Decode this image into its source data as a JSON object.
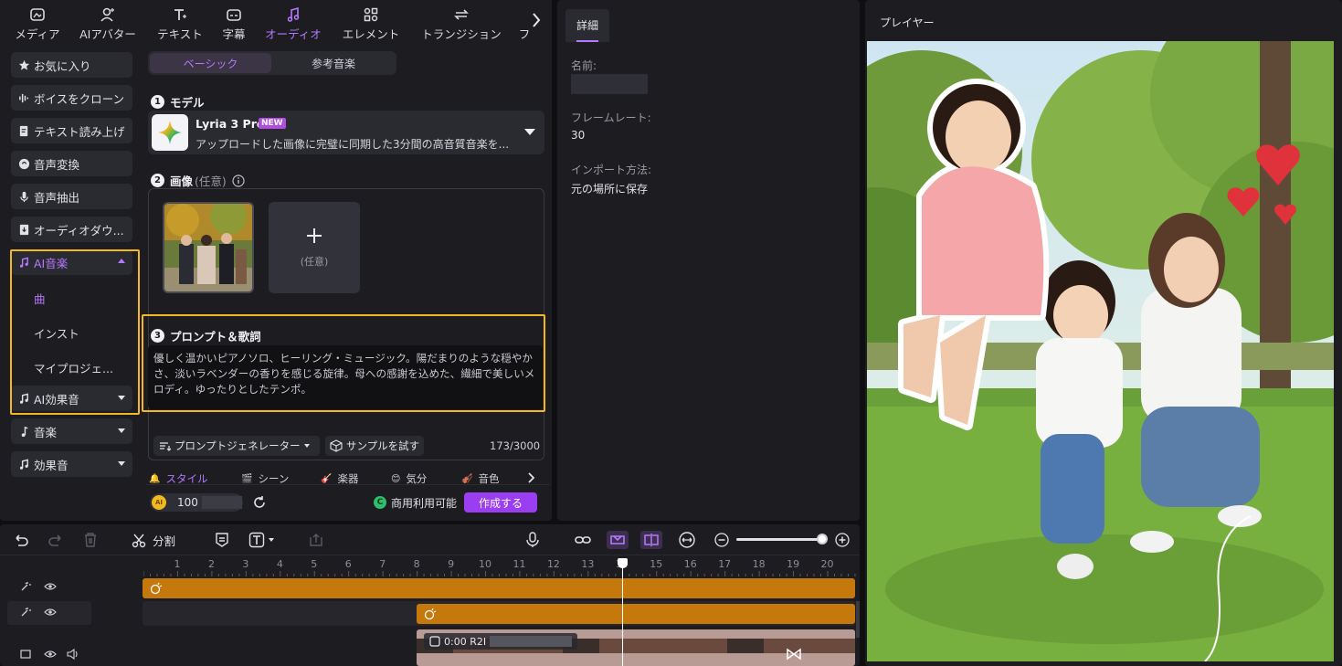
{
  "toolbar": {
    "tabs": [
      {
        "label": "メディア",
        "icon": "media-icon"
      },
      {
        "label": "AIアバター",
        "icon": "avatar-icon"
      },
      {
        "label": "テキスト",
        "icon": "text-icon"
      },
      {
        "label": "字幕",
        "icon": "subtitle-icon"
      },
      {
        "label": "オーディオ",
        "icon": "audio-icon",
        "active": true
      },
      {
        "label": "エレメント",
        "icon": "element-icon"
      },
      {
        "label": "トランジション",
        "icon": "transition-icon"
      },
      {
        "label": "フ",
        "icon": "more-icon"
      }
    ]
  },
  "sidebar": {
    "items": [
      {
        "label": "お気に入り",
        "icon": "star-icon"
      },
      {
        "label": "ボイスをクローン",
        "icon": "voice-clone-icon"
      },
      {
        "label": "テキスト読み上げ",
        "icon": "tts-icon"
      },
      {
        "label": "音声変換",
        "icon": "voice-change-icon"
      },
      {
        "label": "音声抽出",
        "icon": "mic-icon"
      },
      {
        "label": "オーディオダウ...",
        "icon": "download-icon"
      }
    ],
    "ai_music": {
      "label": "AI音楽",
      "subitems": [
        "曲",
        "インスト",
        "マイプロジェ..."
      ]
    },
    "ai_sfx": {
      "label": "AI効果音"
    },
    "music": {
      "label": "音楽"
    },
    "sfx": {
      "label": "効果音"
    }
  },
  "music_panel": {
    "tabs": [
      "ベーシック",
      "参考音楽"
    ],
    "model_title": "モデル",
    "model_name": "Lyria 3 Pro",
    "model_badge": "NEW",
    "model_desc": "アップロードした画像に完璧に同期した3分間の高音質音楽を...",
    "image_title": "画像",
    "image_optional": "(任意)",
    "add_optional": "(任意)",
    "prompt_title": "プロンプト＆歌詞",
    "prompt_text": "優しく温かいピアノソロ、ヒーリング・ミュージック。陽だまりのような穏やかさ、淡いラベンダーの香りを感じる旋律。母への感謝を込めた、繊細で美しいメロディ。ゆったりとしたテンポ。",
    "prompt_generator": "プロンプトジェネレーター",
    "try_sample": "サンプルを試す",
    "char_count": "173/3000",
    "style_tabs": [
      "スタイル",
      "シーン",
      "楽器",
      "気分",
      "音色"
    ],
    "credits": "100",
    "commercial": "商用利用可能",
    "create": "作成する"
  },
  "details": {
    "tab": "詳細",
    "name_label": "名前:",
    "framerate_label": "フレームレート:",
    "framerate_value": "30",
    "import_label": "インポート方法:",
    "import_value": "元の場所に保存"
  },
  "player": {
    "title": "プレイヤー"
  },
  "timeline": {
    "split_label": "分割",
    "ruler": [
      "1",
      "2",
      "3",
      "4",
      "5",
      "6",
      "7",
      "8",
      "9",
      "10",
      "11",
      "12",
      "13",
      "14",
      "15",
      "16",
      "17",
      "18",
      "19",
      "20"
    ],
    "clip_label": "0:00 R2I"
  },
  "colors": {
    "accent": "#b678ff",
    "highlight": "#f3b81f",
    "clip": "#c5790d",
    "create": "#9b3df0"
  }
}
